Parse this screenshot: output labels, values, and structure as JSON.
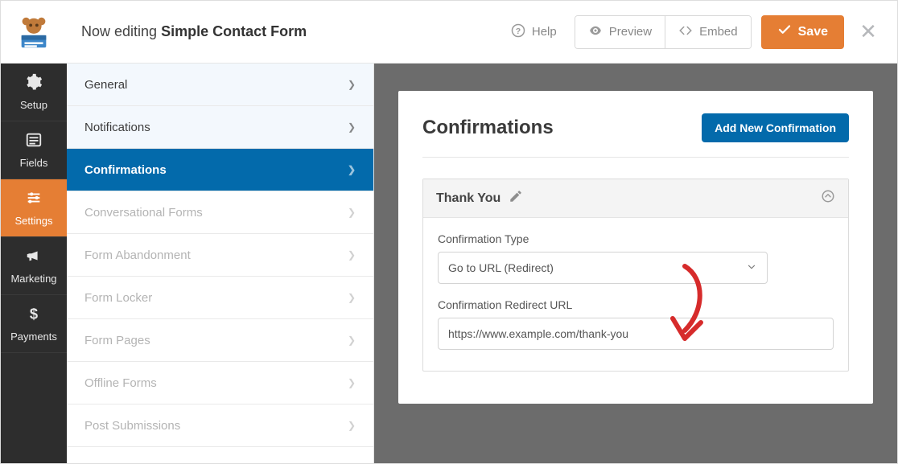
{
  "header": {
    "editing_prefix": "Now editing",
    "form_name": "Simple Contact Form",
    "help_label": "Help",
    "preview_label": "Preview",
    "embed_label": "Embed",
    "save_label": "Save"
  },
  "leftnav": {
    "items": [
      {
        "key": "setup",
        "label": "Setup"
      },
      {
        "key": "fields",
        "label": "Fields"
      },
      {
        "key": "settings",
        "label": "Settings"
      },
      {
        "key": "marketing",
        "label": "Marketing"
      },
      {
        "key": "payments",
        "label": "Payments"
      }
    ],
    "active": "settings"
  },
  "settings_menu": {
    "items": [
      {
        "label": "General",
        "state": "top"
      },
      {
        "label": "Notifications",
        "state": "top"
      },
      {
        "label": "Confirmations",
        "state": "active"
      },
      {
        "label": "Conversational Forms",
        "state": "disabled"
      },
      {
        "label": "Form Abandonment",
        "state": "disabled"
      },
      {
        "label": "Form Locker",
        "state": "disabled"
      },
      {
        "label": "Form Pages",
        "state": "disabled"
      },
      {
        "label": "Offline Forms",
        "state": "disabled"
      },
      {
        "label": "Post Submissions",
        "state": "disabled"
      }
    ]
  },
  "panel": {
    "title": "Confirmations",
    "add_button_label": "Add New Confirmation",
    "card": {
      "title": "Thank You",
      "fields": {
        "type_label": "Confirmation Type",
        "type_value": "Go to URL (Redirect)",
        "url_label": "Confirmation Redirect URL",
        "url_value": "https://www.example.com/thank-you"
      }
    }
  }
}
